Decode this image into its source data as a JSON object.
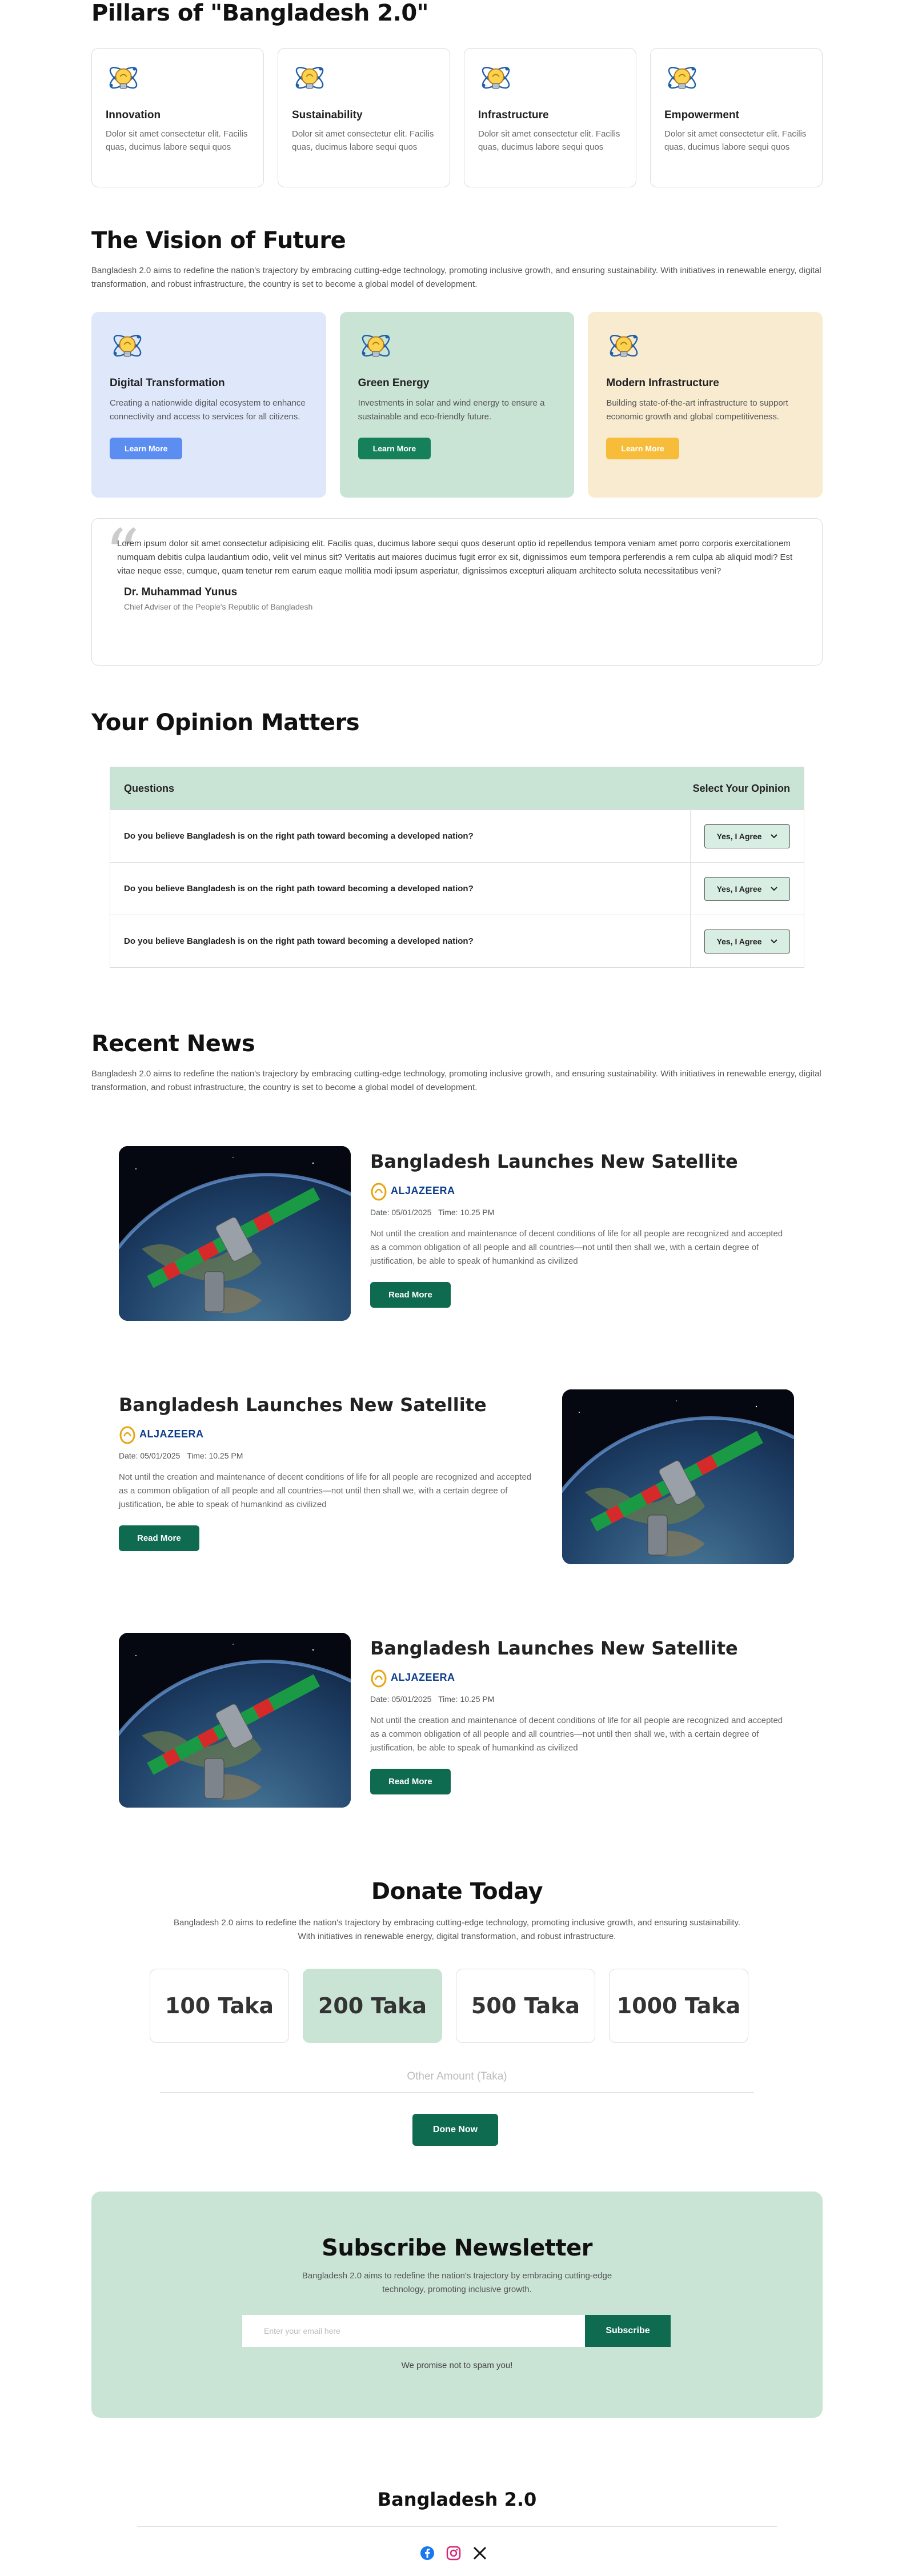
{
  "pillars": {
    "title": "Pillars of \"Bangladesh 2.0\"",
    "cards": [
      {
        "title": "Innovation",
        "desc": "Dolor sit amet consectetur elit. Facilis quas, ducimus labore sequi quos"
      },
      {
        "title": "Sustainability",
        "desc": "Dolor sit amet consectetur elit. Facilis quas, ducimus labore sequi quos"
      },
      {
        "title": "Infrastructure",
        "desc": "Dolor sit amet consectetur elit. Facilis quas, ducimus labore sequi quos"
      },
      {
        "title": "Empowerment",
        "desc": "Dolor sit amet consectetur elit. Facilis quas, ducimus labore sequi quos"
      }
    ]
  },
  "vision": {
    "title": "The Vision of Future",
    "intro": "Bangladesh 2.0 aims to redefine the nation's trajectory by embracing cutting-edge technology, promoting inclusive growth, and ensuring sustainability. With initiatives in renewable energy, digital transformation, and robust infrastructure, the country is set to become a global model of development.",
    "cards": [
      {
        "title": "Digital Transformation",
        "desc": "Creating a nationwide digital ecosystem to enhance connectivity and access to services for all citizens.",
        "button": "Learn More",
        "bg": "#dfe8fb",
        "btn_color": "#5c8ef2"
      },
      {
        "title": "Green Energy",
        "desc": "Investments in solar and wind energy to ensure a sustainable and eco-friendly future.",
        "button": "Learn More",
        "bg": "#c9e3d5",
        "btn_color": "#15805a"
      },
      {
        "title": "Modern Infrastructure",
        "desc": "Building state-of-the-art infrastructure to support economic growth and global competitiveness.",
        "button": "Learn More",
        "bg": "#f8ebd0",
        "btn_color": "#f7bd3a"
      }
    ],
    "quote": {
      "text": "Lorem ipsum dolor sit amet consectetur adipisicing elit. Facilis quas, ducimus labore sequi quos deserunt optio id repellendus tempora veniam amet porro corporis exercitationem numquam debitis culpa laudantium odio, velit vel minus sit? Veritatis aut maiores ducimus fugit error ex sit, dignissimos eum tempora perferendis a rem culpa ab aliquid modi? Est vitae neque esse, cumque, quam tenetur rem earum eaque mollitia modi ipsum asperiatur, dignissimos excepturi aliquam architecto soluta necessitatibus veni?",
      "name": "Dr. Muhammad Yunus",
      "role": "Chief Adviser of the People's Republic of Bangladesh"
    }
  },
  "opinion": {
    "title": "Your Opinion Matters",
    "col_questions": "Questions",
    "col_select": "Select Your Opinion",
    "rows": [
      {
        "question": "Do you believe Bangladesh is on the right path toward becoming a developed nation?",
        "selected": "Yes, I Agree"
      },
      {
        "question": "Do you believe Bangladesh is on the right path toward becoming a developed nation?",
        "selected": "Yes, I Agree"
      },
      {
        "question": "Do you believe Bangladesh is on the right path toward becoming a developed nation?",
        "selected": "Yes, I Agree"
      }
    ]
  },
  "news": {
    "title": "Recent News",
    "intro": "Bangladesh 2.0 aims to redefine the nation's trajectory by embracing cutting-edge technology, promoting inclusive growth, and ensuring sustainability. With initiatives in renewable energy, digital transformation, and robust infrastructure, the country is set to become a global model of development.",
    "items": [
      {
        "headline": "Bangladesh Launches New Satellite",
        "source": "ALJAZEERA",
        "date": "Date: 05/01/2025",
        "time": "Time: 10.25 PM",
        "desc": "Not until the creation and maintenance of decent conditions of life for all people are recognized and accepted as a common obligation of all people and all countries—not until then shall we, with a certain degree of justification, be able to speak of humankind as civilized",
        "button": "Read More"
      },
      {
        "headline": "Bangladesh Launches New Satellite",
        "source": "ALJAZEERA",
        "date": "Date: 05/01/2025",
        "time": "Time: 10.25 PM",
        "desc": "Not until the creation and maintenance of decent conditions of life for all people are recognized and accepted as a common obligation of all people and all countries—not until then shall we, with a certain degree of justification, be able to speak of humankind as civilized",
        "button": "Read More"
      },
      {
        "headline": "Bangladesh Launches New Satellite",
        "source": "ALJAZEERA",
        "date": "Date: 05/01/2025",
        "time": "Time: 10.25 PM",
        "desc": "Not until the creation and maintenance of decent conditions of life for all people are recognized and accepted as a common obligation of all people and all countries—not until then shall we, with a certain degree of justification, be able to speak of humankind as civilized",
        "button": "Read More"
      }
    ]
  },
  "donate": {
    "title": "Donate Today",
    "intro1": "Bangladesh 2.0 aims to redefine the nation's trajectory by embracing cutting-edge technology, promoting inclusive growth, and ensuring sustainability.",
    "intro2": "With initiatives in renewable energy, digital transformation, and robust infrastructure.",
    "amounts": [
      "100 Taka",
      "200 Taka",
      "500 Taka",
      "1000 Taka"
    ],
    "selected_amount": "200 Taka",
    "other_placeholder": "Other Amount (Taka)",
    "button": "Done Now"
  },
  "newsletter": {
    "title": "Subscribe Newsletter",
    "intro1": "Bangladesh 2.0 aims to redefine the nation's trajectory by embracing cutting-edge",
    "intro2": "technology, promoting inclusive growth.",
    "placeholder": "Enter your email here",
    "button": "Subscribe",
    "note": "We promise not to spam you!"
  },
  "footer": {
    "brand": "Bangladesh 2.0",
    "social_icons": [
      "facebook-icon",
      "instagram-icon",
      "x-icon"
    ]
  },
  "colors": {
    "primary": "#0e6b4f",
    "mint": "#c9e3d5",
    "blue": "#5c8ef2",
    "yellow": "#f7bd3a"
  }
}
